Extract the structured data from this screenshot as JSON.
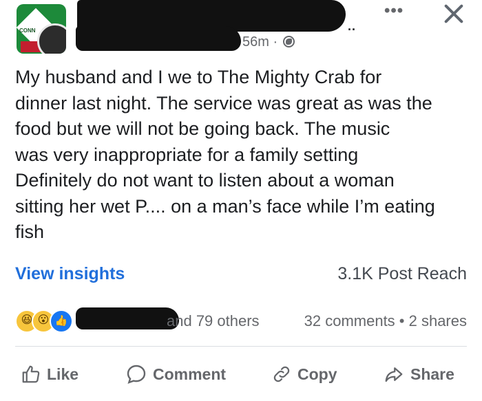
{
  "header": {
    "avatar_text": "CONN",
    "meta_time": "56m ·",
    "more_label": "•••"
  },
  "post": {
    "lines": [
      "My husband and I we to The Mighty Crab for",
      "dinner last night. The service was great as was the",
      "food but we will not be going back.  The music",
      "was very inappropriate for a family setting",
      "Definitely do not want to listen about a woman",
      "sitting her wet P.... on a man’s face while I’m eating",
      "fish"
    ]
  },
  "insights": {
    "link_label": "View insights",
    "reach_label": "3.1K Post Reach"
  },
  "engagement": {
    "others_text": "and 79 others",
    "counts_text": "32 comments • 2 shares"
  },
  "actions": {
    "like": "Like",
    "comment": "Comment",
    "copy": "Copy",
    "share": "Share"
  }
}
